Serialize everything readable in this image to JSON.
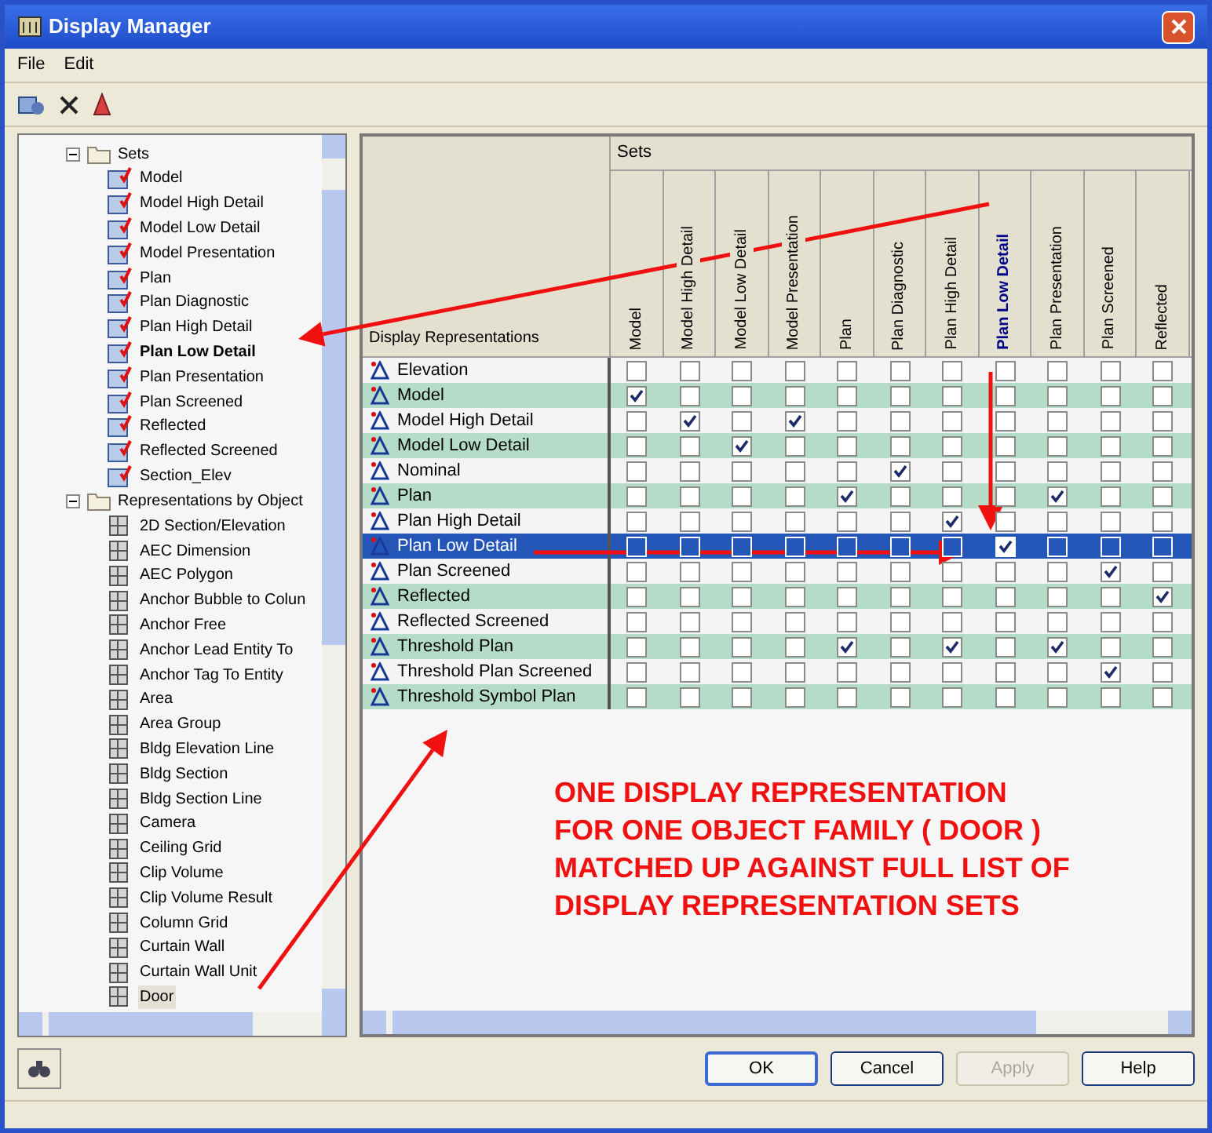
{
  "window": {
    "title": "Display Manager"
  },
  "menu": [
    "File",
    "Edit"
  ],
  "tree": [
    {
      "label": "Sets",
      "expanded": true,
      "kind": "sets",
      "children": [
        {
          "label": "Model",
          "selected": false
        },
        {
          "label": "Model High Detail",
          "selected": false
        },
        {
          "label": "Model Low Detail",
          "selected": false
        },
        {
          "label": "Model Presentation",
          "selected": false
        },
        {
          "label": "Plan",
          "selected": false
        },
        {
          "label": "Plan Diagnostic",
          "selected": false
        },
        {
          "label": "Plan High Detail",
          "selected": false
        },
        {
          "label": "Plan Low Detail",
          "selected": true
        },
        {
          "label": "Plan Presentation",
          "selected": false
        },
        {
          "label": "Plan Screened",
          "selected": false
        },
        {
          "label": "Reflected",
          "selected": false
        },
        {
          "label": "Reflected Screened",
          "selected": false
        },
        {
          "label": "Section_Elev",
          "selected": false
        }
      ]
    },
    {
      "label": "Representations by Object",
      "expanded": true,
      "kind": "objects",
      "children": [
        {
          "label": "2D Section/Elevation",
          "selected": false
        },
        {
          "label": "AEC Dimension",
          "selected": false
        },
        {
          "label": "AEC Polygon",
          "selected": false
        },
        {
          "label": "Anchor Bubble to Colun",
          "selected": false
        },
        {
          "label": "Anchor Free",
          "selected": false
        },
        {
          "label": "Anchor Lead Entity To",
          "selected": false
        },
        {
          "label": "Anchor Tag To Entity",
          "selected": false
        },
        {
          "label": "Area",
          "selected": false
        },
        {
          "label": "Area Group",
          "selected": false
        },
        {
          "label": "Bldg Elevation Line",
          "selected": false
        },
        {
          "label": "Bldg Section",
          "selected": false
        },
        {
          "label": "Bldg Section Line",
          "selected": false
        },
        {
          "label": "Camera",
          "selected": false
        },
        {
          "label": "Ceiling Grid",
          "selected": false
        },
        {
          "label": "Clip Volume",
          "selected": false
        },
        {
          "label": "Clip Volume Result",
          "selected": false
        },
        {
          "label": "Column Grid",
          "selected": false
        },
        {
          "label": "Curtain Wall",
          "selected": false
        },
        {
          "label": "Curtain Wall Unit",
          "selected": false
        },
        {
          "label": "Door",
          "selected": true
        }
      ]
    }
  ],
  "matrix": {
    "corner_label": "Display Representations",
    "group_label": "Sets",
    "columns": [
      {
        "label": "Model",
        "selected": false
      },
      {
        "label": "Model High Detail",
        "selected": false
      },
      {
        "label": "Model Low Detail",
        "selected": false
      },
      {
        "label": "Model Presentation",
        "selected": false
      },
      {
        "label": "Plan",
        "selected": false
      },
      {
        "label": "Plan Diagnostic",
        "selected": false
      },
      {
        "label": "Plan High Detail",
        "selected": false
      },
      {
        "label": "Plan Low Detail",
        "selected": true
      },
      {
        "label": "Plan Presentation",
        "selected": false
      },
      {
        "label": "Plan Screened",
        "selected": false
      },
      {
        "label": "Reflected",
        "selected": false
      }
    ],
    "rows": [
      {
        "label": "Elevation",
        "selected": false,
        "checks": [
          false,
          false,
          false,
          false,
          false,
          false,
          false,
          false,
          false,
          false,
          false
        ]
      },
      {
        "label": "Model",
        "selected": false,
        "checks": [
          true,
          false,
          false,
          false,
          false,
          false,
          false,
          false,
          false,
          false,
          false
        ]
      },
      {
        "label": "Model High Detail",
        "selected": false,
        "checks": [
          false,
          true,
          false,
          true,
          false,
          false,
          false,
          false,
          false,
          false,
          false
        ]
      },
      {
        "label": "Model Low Detail",
        "selected": false,
        "checks": [
          false,
          false,
          true,
          false,
          false,
          false,
          false,
          false,
          false,
          false,
          false
        ]
      },
      {
        "label": "Nominal",
        "selected": false,
        "checks": [
          false,
          false,
          false,
          false,
          false,
          true,
          false,
          false,
          false,
          false,
          false
        ]
      },
      {
        "label": "Plan",
        "selected": false,
        "checks": [
          false,
          false,
          false,
          false,
          true,
          false,
          false,
          false,
          true,
          false,
          false
        ]
      },
      {
        "label": "Plan High Detail",
        "selected": false,
        "checks": [
          false,
          false,
          false,
          false,
          false,
          false,
          true,
          false,
          false,
          false,
          false
        ]
      },
      {
        "label": "Plan Low Detail",
        "selected": true,
        "checks": [
          false,
          false,
          false,
          false,
          false,
          false,
          false,
          true,
          false,
          false,
          false
        ]
      },
      {
        "label": "Plan Screened",
        "selected": false,
        "checks": [
          false,
          false,
          false,
          false,
          false,
          false,
          false,
          false,
          false,
          true,
          false
        ]
      },
      {
        "label": "Reflected",
        "selected": false,
        "checks": [
          false,
          false,
          false,
          false,
          false,
          false,
          false,
          false,
          false,
          false,
          true
        ]
      },
      {
        "label": "Reflected Screened",
        "selected": false,
        "checks": [
          false,
          false,
          false,
          false,
          false,
          false,
          false,
          false,
          false,
          false,
          false
        ]
      },
      {
        "label": "Threshold Plan",
        "selected": false,
        "checks": [
          false,
          false,
          false,
          false,
          true,
          false,
          true,
          false,
          true,
          false,
          false
        ]
      },
      {
        "label": "Threshold Plan Screened",
        "selected": false,
        "checks": [
          false,
          false,
          false,
          false,
          false,
          false,
          false,
          false,
          false,
          true,
          false
        ]
      },
      {
        "label": "Threshold Symbol Plan",
        "selected": false,
        "checks": [
          false,
          false,
          false,
          false,
          false,
          false,
          false,
          false,
          false,
          false,
          false
        ]
      }
    ]
  },
  "annotation": [
    "ONE DISPLAY REPRESENTATION",
    "FOR ONE OBJECT FAMILY ( DOOR )",
    "MATCHED UP AGAINST FULL LIST OF",
    "DISPLAY REPRESENTATION SETS"
  ],
  "buttons": [
    {
      "label": "OK",
      "disabled": false,
      "default": true
    },
    {
      "label": "Cancel",
      "disabled": false,
      "default": false
    },
    {
      "label": "Apply",
      "disabled": true,
      "default": false
    },
    {
      "label": "Help",
      "disabled": false,
      "default": false
    }
  ]
}
